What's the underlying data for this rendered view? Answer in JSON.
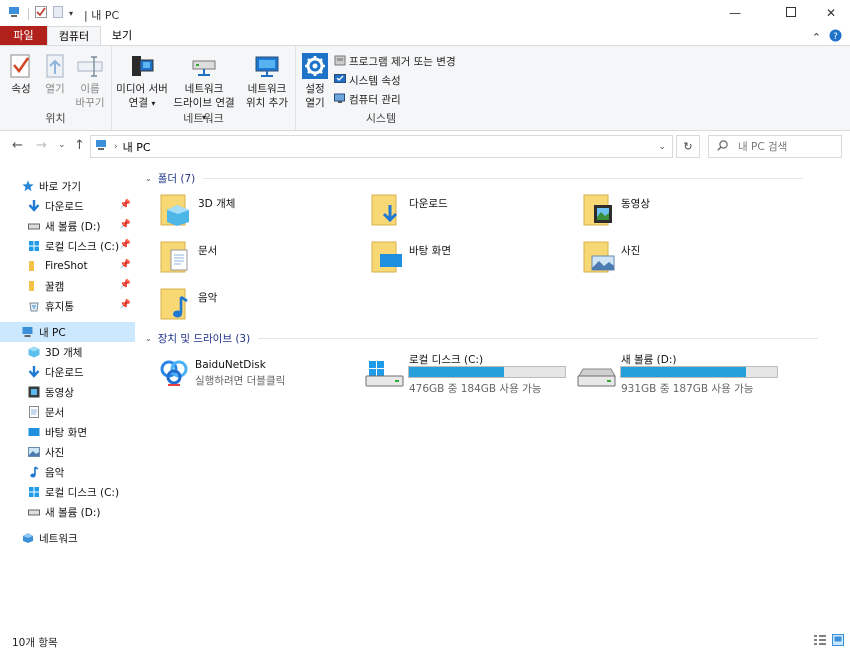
{
  "window": {
    "title": "내 PC",
    "breadcrumb_sep": "|"
  },
  "tabs": {
    "file": "파일",
    "computer": "컴퓨터",
    "view": "보기"
  },
  "ribbon": {
    "location": {
      "label": "위치",
      "properties": "속성",
      "open": "열기",
      "rename_l1": "이름",
      "rename_l2": "바꾸기"
    },
    "network": {
      "label": "네트워크",
      "media_l1": "미디어 서버",
      "media_l2": "연결",
      "drive_l1": "네트워크",
      "drive_l2": "드라이브 연결",
      "loc_l1": "네트워크",
      "loc_l2": "위치 추가"
    },
    "system": {
      "label": "시스템",
      "settings_l1": "설정",
      "settings_l2": "열기",
      "uninstall": "프로그램 제거 또는 변경",
      "sysprops": "시스템 속성",
      "manage": "컴퓨터 관리"
    }
  },
  "address": {
    "path": "내 PC",
    "search_placeholder": "내 PC 검색"
  },
  "sidebar": {
    "quick_access": "바로 가기",
    "quick_items": [
      "다운로드",
      "새 볼륨 (D:)",
      "로컬 디스크 (C:)",
      "FireShot",
      "꿀캠",
      "휴지통"
    ],
    "this_pc": "내 PC",
    "pc_items": [
      "3D 개체",
      "다운로드",
      "동영상",
      "문서",
      "바탕 화면",
      "사진",
      "음악",
      "로컬 디스크 (C:)",
      "새 볼륨 (D:)"
    ],
    "network": "네트워크"
  },
  "folders": {
    "header": "폴더 (7)",
    "items": [
      "3D 개체",
      "다운로드",
      "동영상",
      "문서",
      "바탕 화면",
      "사진",
      "음악"
    ]
  },
  "drives": {
    "header": "장치 및 드라이브 (3)",
    "baidu": {
      "name": "BaiduNetDisk",
      "sub": "실행하려면 더블클릭"
    },
    "c": {
      "name": "로컬 디스크 (C:)",
      "info": "476GB 중 184GB 사용 가능",
      "used_fraction": 0.61
    },
    "d": {
      "name": "새 볼륨 (D:)",
      "info": "931GB 중 187GB 사용 가능",
      "used_fraction": 0.8
    }
  },
  "status": {
    "count": "10개 항목"
  },
  "colors": {
    "file_tab": "#b0211c",
    "folder": "#f8d775",
    "accent": "#26a0da",
    "selection": "#cce8ff",
    "header_text": "#1e3287"
  }
}
